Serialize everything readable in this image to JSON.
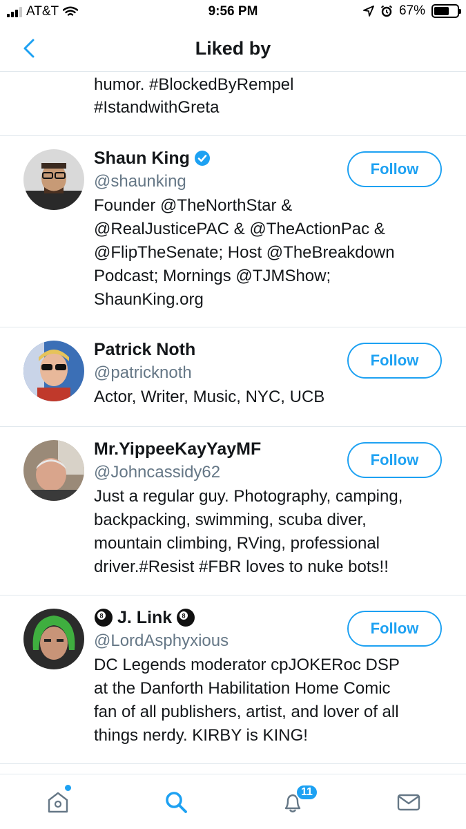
{
  "status_bar": {
    "carrier": "AT&T",
    "time": "9:56 PM",
    "battery": "67%",
    "battery_level": 0.67
  },
  "header": {
    "title": "Liked by"
  },
  "partial_bio": {
    "line1": "humor. #BlockedByRempel",
    "line2": "#IstandwithGreta"
  },
  "users": [
    {
      "name": "Shaun King",
      "verified": true,
      "handle": "@shaunking",
      "bio_lines": [
        "Founder @TheNorthStar &",
        "@RealJusticePAC & @TheActionPac &",
        "@FlipTheSenate; Host @TheBreakdown",
        "Podcast; Mornings @TJMShow;",
        "ShaunKing.org"
      ],
      "follow_label": "Follow"
    },
    {
      "name": "Patrick Noth",
      "handle": "@patricknoth",
      "bio_lines": [
        "Actor, Writer, Music, NYC, UCB"
      ],
      "follow_label": "Follow"
    },
    {
      "name": "Mr.YippeeKayYayMF",
      "handle": "@Johncassidy62",
      "bio_lines": [
        "Just a regular guy. Photography, camping,",
        "backpacking, swimming, scuba diver,",
        "mountain climbing, RVing, professional",
        "driver.#Resist #FBR loves to nuke bots!!"
      ],
      "follow_label": "Follow"
    },
    {
      "name": "J. Link",
      "handle": "@LordAsphyxious",
      "bio_lines": [
        "DC Legends moderator cpJOKERoc DSP",
        "at the Danforth Habilitation Home Comic",
        "fan of all publishers, artist, and lover of all",
        "things nerdy. KIRBY is KING!"
      ],
      "follow_label": "Follow"
    }
  ],
  "tab_bar": {
    "items": [
      "home-icon",
      "search-icon",
      "notifications-icon",
      "messages-icon"
    ],
    "notifications_badge": "11",
    "active": "search"
  },
  "colors": {
    "accent": "#1da1f2",
    "text": "#14171a",
    "secondary": "#657786",
    "divider": "#e1e8ed"
  }
}
